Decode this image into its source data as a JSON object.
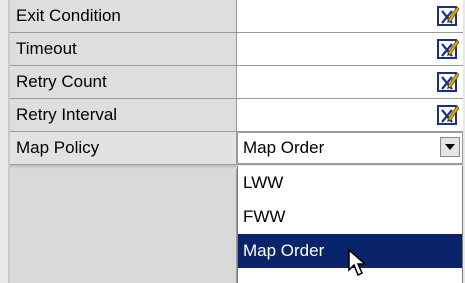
{
  "properties": [
    {
      "label": "Exit Condition",
      "value": ""
    },
    {
      "label": "Timeout",
      "value": ""
    },
    {
      "label": "Retry Count",
      "value": ""
    },
    {
      "label": "Retry Interval",
      "value": ""
    }
  ],
  "edit_icon": "edit-pencil-icon",
  "map_policy": {
    "label": "Map Policy",
    "selected": "Map Order",
    "options": [
      "LWW",
      "FWW",
      "Map Order"
    ],
    "highlighted_index": 2
  },
  "colors": {
    "selection_bg": "#0a246a",
    "selection_text": "#ffffff"
  }
}
